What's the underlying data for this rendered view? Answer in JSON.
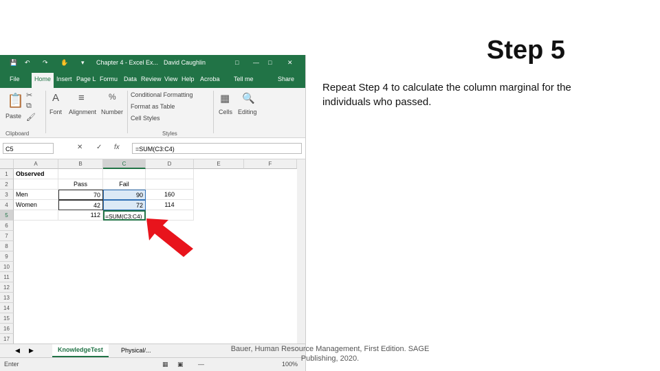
{
  "slide": {
    "title": "Step 5",
    "body": "Repeat Step 4 to calculate the column marginal for the individuals who passed.",
    "citation_line1": "Bauer, Human Resource Management, First Edition. SAGE",
    "citation_line2": "Publishing, 2020."
  },
  "excel": {
    "window_title": "Chapter 4 - Excel Ex...",
    "user_name": "David Caughlin",
    "tabs": [
      "File",
      "Home",
      "Insert",
      "Page L",
      "Formu",
      "Data",
      "Review",
      "View",
      "Help",
      "Acroba",
      "Tell me",
      "Share"
    ],
    "ribbon": {
      "paste": "Paste",
      "font": "Font",
      "alignment": "Alignment",
      "number": "Number",
      "conditional_formatting": "Conditional Formatting",
      "format_as_table": "Format as Table",
      "cell_styles": "Cell Styles",
      "cells": "Cells",
      "editing": "Editing",
      "clipboard_group": "Clipboard",
      "styles_group": "Styles"
    },
    "name_box": "C5",
    "formula": "=SUM(C3:C4)",
    "columns": [
      "A",
      "B",
      "C",
      "D",
      "E",
      "F"
    ],
    "rows": [
      "1",
      "2",
      "3",
      "4",
      "5",
      "6",
      "7",
      "8",
      "9",
      "10",
      "11",
      "12",
      "13",
      "14",
      "15",
      "16",
      "17"
    ],
    "cells": {
      "A1": "Observed",
      "B2": "Pass",
      "C2": "Fail",
      "A3": "Men",
      "B3": "70",
      "C3": "90",
      "D3": "160",
      "A4": "Women",
      "B4": "42",
      "C4": "72",
      "D4": "114",
      "B5": "112",
      "C5": "=SUM(C3:C4)"
    },
    "sheet_tabs": [
      "KnowledgeTest",
      "Physical/..."
    ],
    "status": "Enter",
    "zoom": "100%"
  },
  "colors": {
    "excel_green": "#217346",
    "arrow_red": "#e8141c",
    "range_highlight": "#dce9f6"
  }
}
